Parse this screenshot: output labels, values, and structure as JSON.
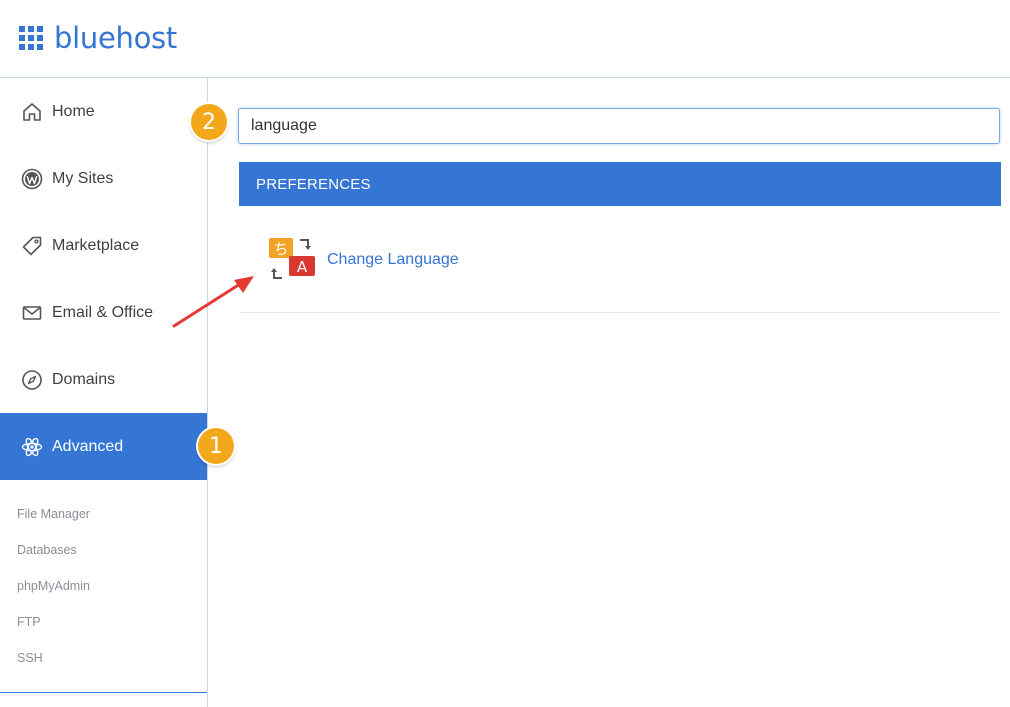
{
  "app": {
    "brand": "bluehost"
  },
  "sidebar": {
    "items": [
      {
        "label": "Home",
        "icon": "home-icon"
      },
      {
        "label": "My Sites",
        "icon": "wordpress-icon"
      },
      {
        "label": "Marketplace",
        "icon": "tag-icon"
      },
      {
        "label": "Email & Office",
        "icon": "envelope-icon"
      },
      {
        "label": "Domains",
        "icon": "compass-icon"
      },
      {
        "label": "Advanced",
        "icon": "atom-icon",
        "active": true
      }
    ],
    "sub_links": [
      "File Manager",
      "Databases",
      "phpMyAdmin",
      "FTP",
      "SSH"
    ]
  },
  "search": {
    "value": "language"
  },
  "results": {
    "section_title": "PREFERENCES",
    "items": [
      {
        "label": "Change Language",
        "icon": "language-translate-icon",
        "glyph_jp": "ち",
        "glyph_en": "A"
      }
    ]
  },
  "annotations": {
    "badge_1": "1",
    "badge_2": "2"
  },
  "colors": {
    "brand_blue": "#3575d3",
    "badge_orange": "#f3a81b",
    "arrow_red": "#e53935"
  }
}
